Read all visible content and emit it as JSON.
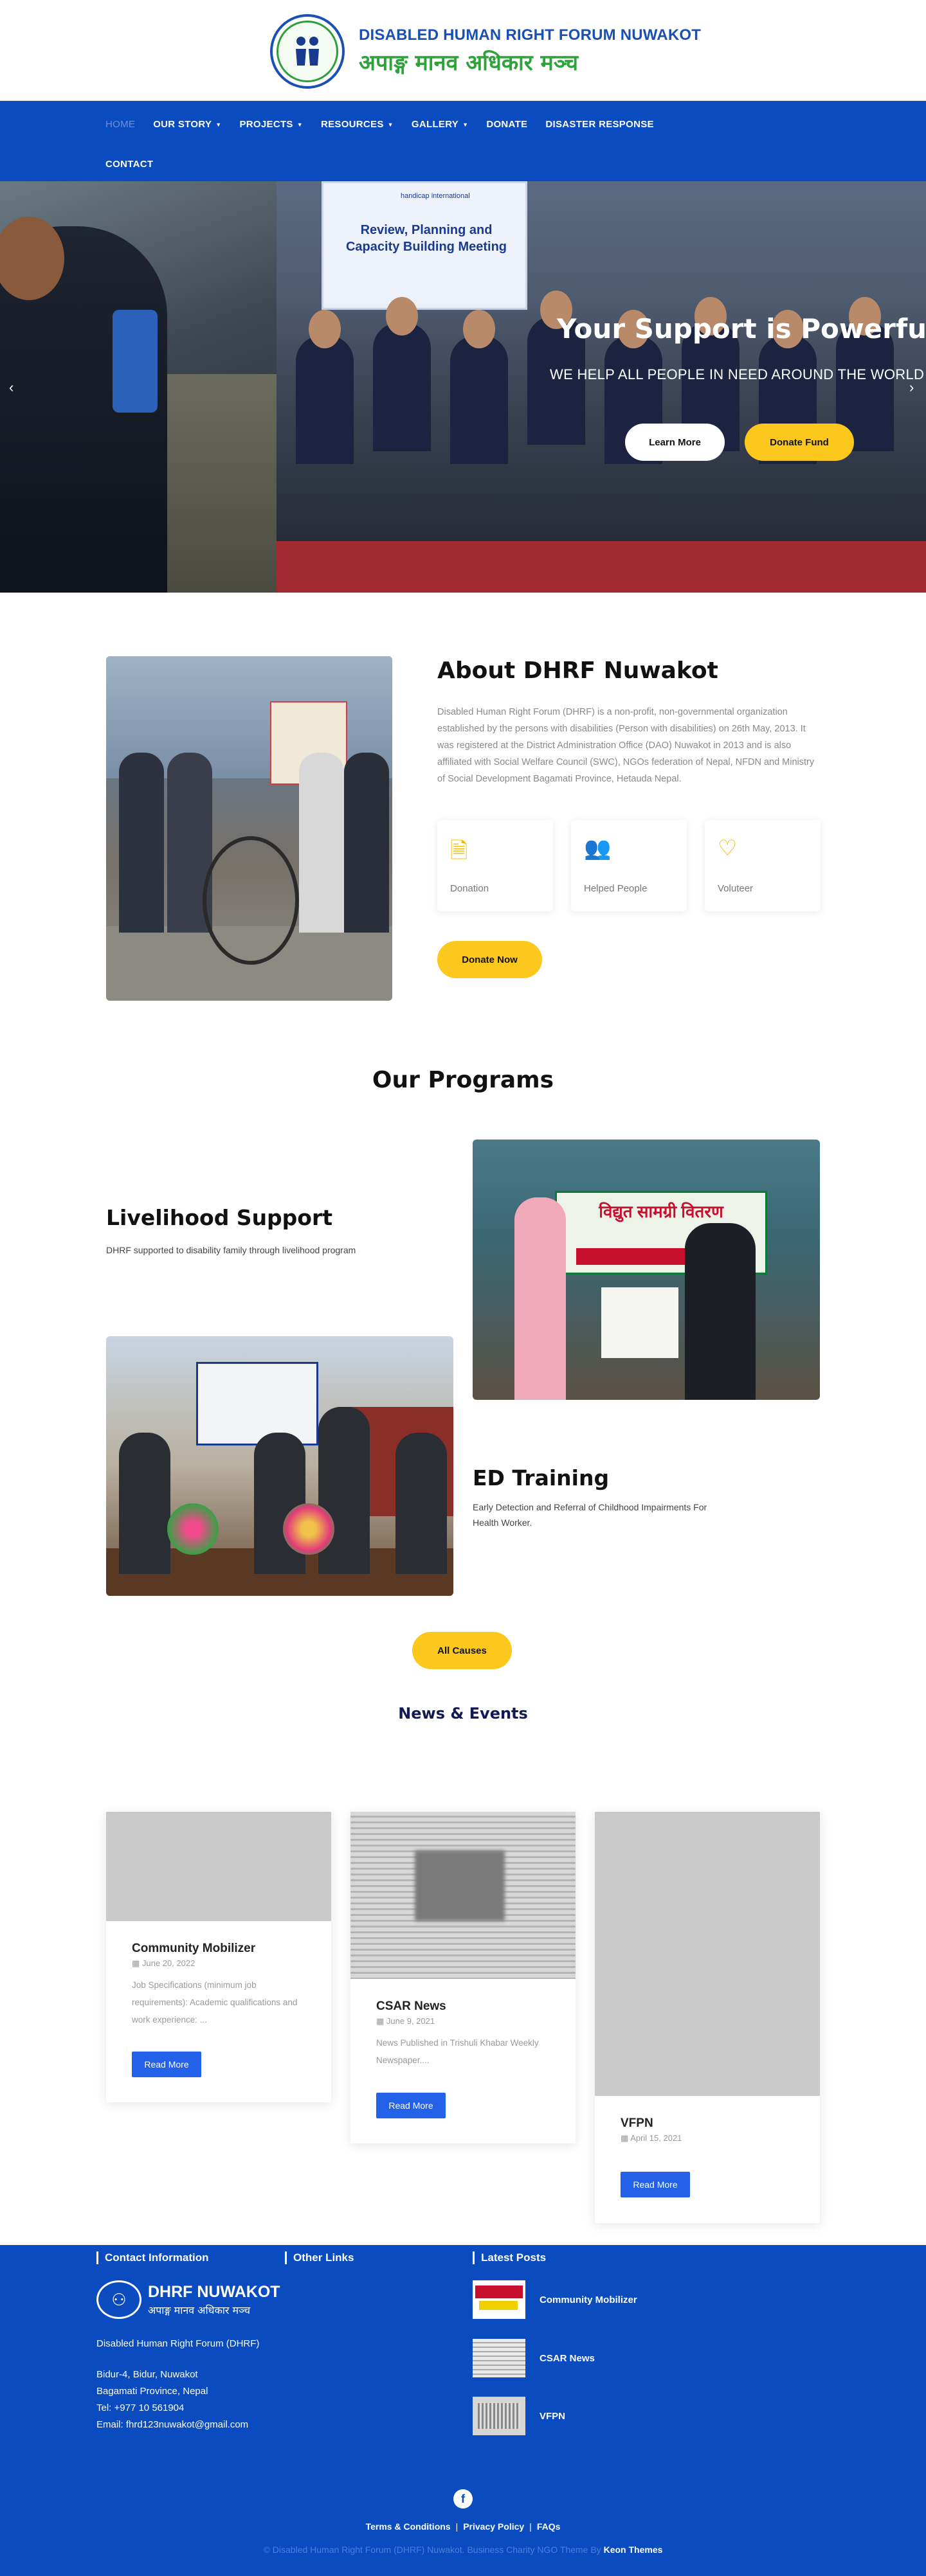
{
  "brand": {
    "name_en": "DISABLED HUMAN RIGHT FORUM NUWAKOT",
    "name_np": "अपाङ्ग मानव अधिकार मञ्च"
  },
  "nav": {
    "row1": [
      {
        "label": "HOME",
        "active": true,
        "dropdown": false
      },
      {
        "label": "OUR STORY",
        "active": false,
        "dropdown": true
      },
      {
        "label": "PROJECTS",
        "active": false,
        "dropdown": true
      },
      {
        "label": "RESOURCES",
        "active": false,
        "dropdown": true
      },
      {
        "label": "GALLERY",
        "active": false,
        "dropdown": true
      },
      {
        "label": "DONATE",
        "active": false,
        "dropdown": false
      },
      {
        "label": "DISASTER RESPONSE",
        "active": false,
        "dropdown": false
      }
    ],
    "row2": [
      {
        "label": "CONTACT",
        "active": false,
        "dropdown": false
      }
    ]
  },
  "hero": {
    "banner_title": "Review, Planning and Capacity Building Meeting",
    "banner_org": "handicap international",
    "title": "Your Support is Powerful.",
    "subtitle": "WE HELP ALL PEOPLE IN NEED AROUND THE WORLD",
    "learn_more": "Learn More",
    "donate_fund": "Donate Fund",
    "prev_arrow": "‹",
    "next_arrow": "›"
  },
  "about": {
    "title": "About DHRF Nuwakot",
    "text": "Disabled Human Right Forum (DHRF) is a non-profit, non-governmental organization established by the persons with disabilities (Person with disabilities) on 26th May, 2013. It was registered at the District Administration Office (DAO) Nuwakot in 2013 and is also affiliated with Social Welfare Council (SWC), NGOs federation of Nepal, NFDN and Ministry of Social Development Bagamati Province, Hetauda Nepal.",
    "cards": [
      {
        "icon": "document-icon",
        "glyph": "🗎",
        "label": "Donation"
      },
      {
        "icon": "users-icon",
        "glyph": "👥",
        "label": "Helped People"
      },
      {
        "icon": "heart-icon",
        "glyph": "♡",
        "label": "Voluteer"
      }
    ],
    "donate_now": "Donate Now"
  },
  "programs": {
    "title": "Our Programs",
    "items": [
      {
        "title": "Livelihood Support",
        "desc": "DHRF supported to disability family through livelihood program"
      },
      {
        "title": "ED Training",
        "desc": "Early Detection and Referral of Childhood Impairments For Health Worker."
      }
    ],
    "sign_text": "विद्युत सामग्री वितरण",
    "all_causes": "All Causes"
  },
  "news": {
    "title": "News & Events",
    "items": [
      {
        "title": "Community Mobilizer",
        "date": "June 20, 2022",
        "excerpt": "Job Specifications (minimum job requirements): Academic qualifications and work experience: ...",
        "button": "Read More"
      },
      {
        "title": "CSAR News",
        "date": "June 9, 2021",
        "excerpt": "News Published in Trishuli Khabar Weekly Newspaper....",
        "button": "Read More"
      },
      {
        "title": "VFPN",
        "date": "April 15, 2021",
        "excerpt": "",
        "button": "Read More"
      }
    ]
  },
  "footer": {
    "contact_head": "Contact Information",
    "links_head": "Other Links",
    "posts_head": "Latest Posts",
    "logo_en": "DHRF NUWAKOT",
    "logo_np": "अपाङ्ग मानव अधिकार मञ्च",
    "org_name": "Disabled Human Right Forum (DHRF)",
    "address1": "Bidur-4, Bidur, Nuwakot",
    "address2": "Bagamati Province, Nepal",
    "tel": "Tel: +977 10 561904",
    "email": "Email: fhrd123nuwakot@gmail.com",
    "latest_posts": [
      "Community Mobilizer",
      "CSAR News",
      "VFPN"
    ],
    "fb_glyph": "f",
    "terms": "Terms & Conditions",
    "privacy": "Privacy Policy",
    "faqs": "FAQs",
    "copyright": "© Disabled Human Right Forum (DHRF) Nuwakot. Business Charity NGO Theme By",
    "theme_author": "Keon Themes"
  }
}
